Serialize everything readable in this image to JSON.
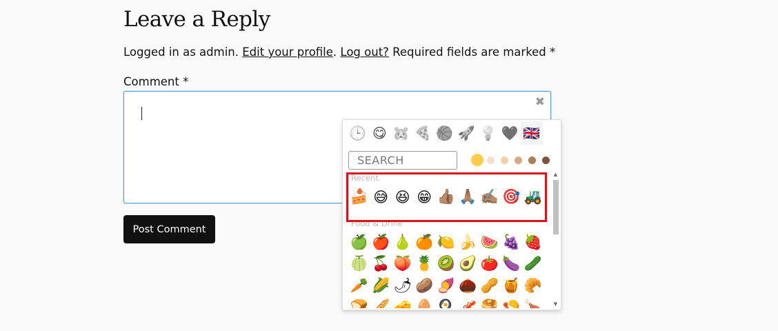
{
  "reply": {
    "title": "Leave a Reply",
    "logged_in_prefix": "Logged in as admin. ",
    "edit_profile_link": "Edit your profile",
    "sep1": ". ",
    "logout_link": "Log out?",
    "required_text": " Required fields are marked *",
    "comment_label": "Comment *",
    "post_button": "Post Comment",
    "close_glyph": "✖"
  },
  "emoji_picker": {
    "categories": [
      {
        "name": "recent",
        "glyph": "🕒"
      },
      {
        "name": "smileys",
        "glyph": "😋"
      },
      {
        "name": "animals",
        "glyph": "🐹"
      },
      {
        "name": "food",
        "glyph": "🍕"
      },
      {
        "name": "activities",
        "glyph": "🏀"
      },
      {
        "name": "travel",
        "glyph": "🚀"
      },
      {
        "name": "objects",
        "glyph": "💡"
      },
      {
        "name": "symbols",
        "glyph": "🖤"
      },
      {
        "name": "flags",
        "glyph": "🇬🇧"
      }
    ],
    "search_placeholder": "SEARCH",
    "skin_tones": [
      "#ffcc4d",
      "#f7dece",
      "#f3d2a2",
      "#d5ab88",
      "#af7e57",
      "#7c533e"
    ],
    "recent_label": "Recent",
    "recent": [
      "🍰",
      "😅",
      "😆",
      "😁",
      "👍🏽",
      "🙏🏽",
      "✍🏽",
      "🎯",
      "🚜"
    ],
    "food_label": "Food & Drink",
    "food": [
      "🍏",
      "🍎",
      "🍐",
      "🍊",
      "🍋",
      "🍌",
      "🍉",
      "🍇",
      "🍓",
      "🍈",
      "🍒",
      "🍑",
      "🍍",
      "🥝",
      "🥑",
      "🍅",
      "🍆",
      "🥒",
      "🥕",
      "🌽",
      "🌶",
      "🥔",
      "🍠",
      "🌰",
      "🥜",
      "🍯",
      "🥐",
      "🍞",
      "🥖",
      "🧀",
      "🥚",
      "🍳",
      "🥓",
      "🥞",
      "🍤",
      "🍗"
    ]
  },
  "colors": {
    "accent_border": "#5b9ee0",
    "button_bg": "#111111",
    "highlight": "#e0101a"
  }
}
